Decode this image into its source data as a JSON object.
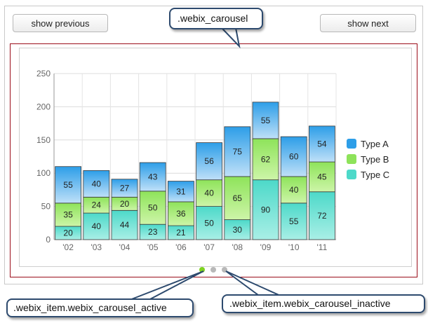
{
  "buttons": {
    "prev_label": "show previous",
    "next_label": "show next"
  },
  "callouts": {
    "carousel": ".webix_carousel",
    "active": ".webix_item.webix_carousel_active",
    "inactive": ".webix_item.webix_carousel_inactive"
  },
  "pager": {
    "dots": [
      {
        "state": "active"
      },
      {
        "state": "inactive"
      },
      {
        "state": "inactive"
      }
    ],
    "colors": {
      "active": "#7ed321",
      "inactive": "#b8b8b8"
    }
  },
  "chart_data": {
    "type": "bar",
    "stacked": true,
    "categories": [
      "'02",
      "'03",
      "'04",
      "'05",
      "'06",
      "'07",
      "'08",
      "'09",
      "'10",
      "'11"
    ],
    "ylim": [
      0,
      250
    ],
    "yticks": [
      0,
      50,
      100,
      150,
      200,
      250
    ],
    "grid": true,
    "legend_position": "right",
    "series": [
      {
        "name": "Type C",
        "values": [
          20,
          40,
          44,
          23,
          21,
          50,
          30,
          90,
          55,
          72
        ],
        "color": "#4dd9c9",
        "color_light": "#a9efe6"
      },
      {
        "name": "Type B",
        "values": [
          35,
          24,
          20,
          50,
          36,
          40,
          65,
          62,
          40,
          45
        ],
        "color": "#8ee35a",
        "color_light": "#cdf5a8"
      },
      {
        "name": "Type A",
        "values": [
          55,
          40,
          27,
          43,
          31,
          56,
          75,
          55,
          60,
          54
        ],
        "color": "#2d9ee8",
        "color_light": "#bfe0f8"
      }
    ]
  }
}
